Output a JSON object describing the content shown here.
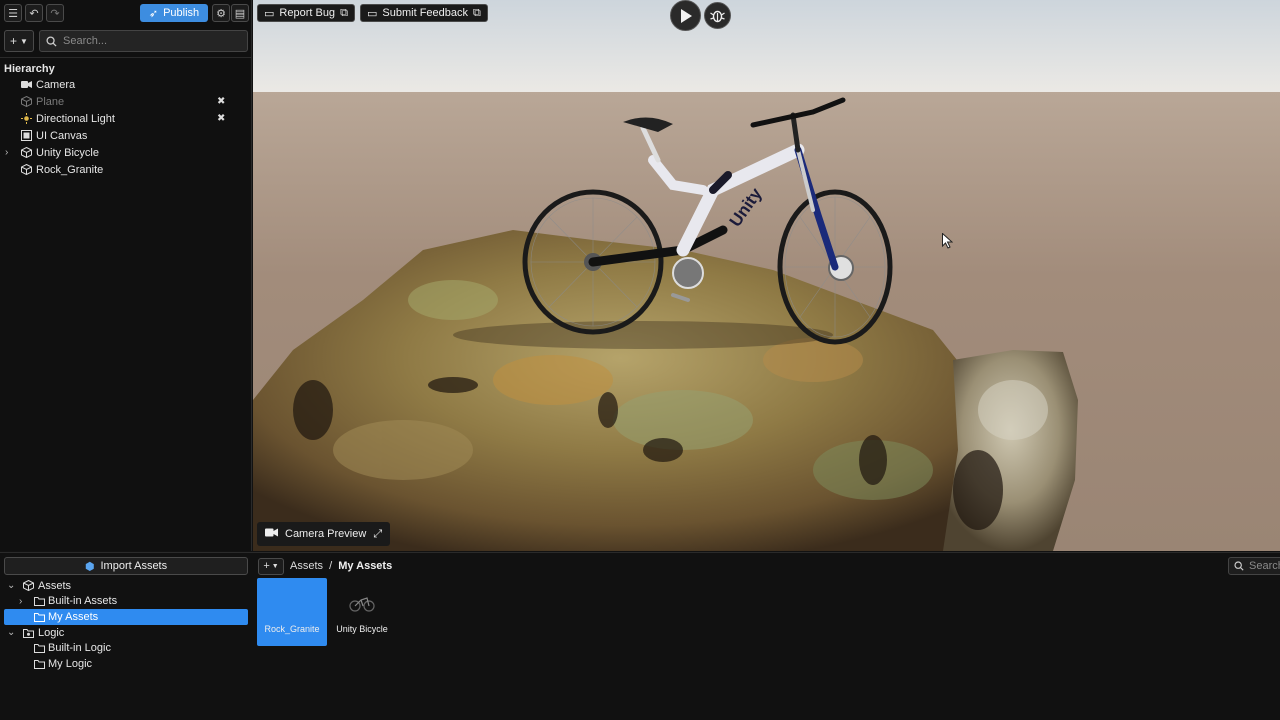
{
  "toolbar": {
    "publish_label": "Publish",
    "report_bug_label": "Report Bug",
    "submit_feedback_label": "Submit Feedback"
  },
  "hierarchy": {
    "search_placeholder": "Search...",
    "title": "Hierarchy",
    "items": [
      {
        "label": "Camera",
        "icon": "camera-icon",
        "dim": false,
        "expandable": false,
        "hidden_toggle": false
      },
      {
        "label": "Plane",
        "icon": "cube-icon",
        "dim": true,
        "expandable": false,
        "hidden_toggle": true
      },
      {
        "label": "Directional Light",
        "icon": "light-icon",
        "dim": false,
        "expandable": false,
        "hidden_toggle": true
      },
      {
        "label": "UI Canvas",
        "icon": "canvas-icon",
        "dim": false,
        "expandable": false,
        "hidden_toggle": false
      },
      {
        "label": "Unity Bicycle",
        "icon": "cube-icon",
        "dim": false,
        "expandable": true,
        "hidden_toggle": false
      },
      {
        "label": "Rock_Granite",
        "icon": "cube-icon",
        "dim": false,
        "expandable": false,
        "hidden_toggle": false
      }
    ]
  },
  "viewport": {
    "camera_preview_label": "Camera Preview"
  },
  "project": {
    "import_label": "Import Assets",
    "tree": [
      {
        "label": "Assets",
        "level": 0,
        "expanded": true,
        "icon": "cube-icon"
      },
      {
        "label": "Built-in Assets",
        "level": 1,
        "expanded": false,
        "icon": "folder-icon"
      },
      {
        "label": "My Assets",
        "level": 1,
        "expanded": false,
        "icon": "folder-icon",
        "selected": true
      },
      {
        "label": "Logic",
        "level": 0,
        "expanded": true,
        "icon": "logic-icon"
      },
      {
        "label": "Built-in Logic",
        "level": 1,
        "expanded": false,
        "icon": "folder-icon"
      },
      {
        "label": "My Logic",
        "level": 1,
        "expanded": false,
        "icon": "folder-icon"
      }
    ],
    "breadcrumb": {
      "root": "Assets",
      "separator": "/",
      "current": "My Assets"
    },
    "search_placeholder": "Search",
    "tiles": [
      {
        "label": "Rock_Granite",
        "selected": true
      },
      {
        "label": "Unity Bicycle",
        "selected": false
      }
    ]
  },
  "colors": {
    "accent": "#2f8bf0",
    "publish": "#3d8de0"
  }
}
